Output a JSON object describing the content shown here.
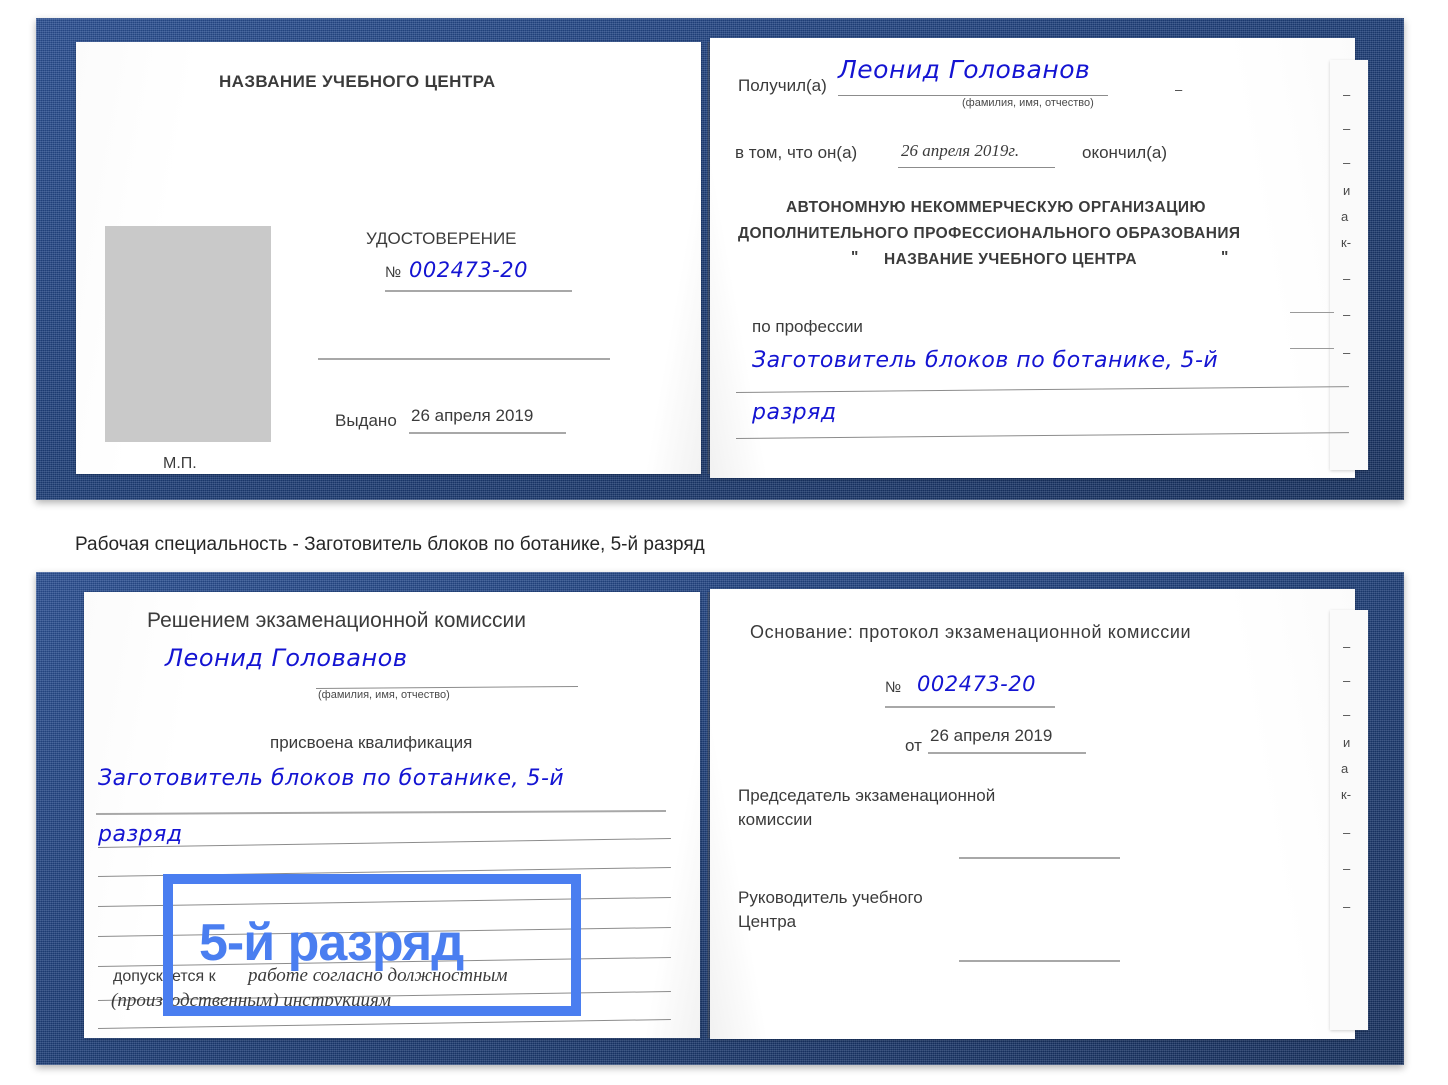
{
  "caption": "Рабочая специальность - Заготовитель блоков по ботанике, 5-й разряд",
  "cover_color": "#1e3f7a",
  "highlight_color": "#4a7ef0",
  "ink_color": "#1414d2",
  "certificate_top": {
    "left_page": {
      "heading": "НАЗВАНИЕ УЧЕБНОГО ЦЕНТРА",
      "doc_type": "УДОСТОВЕРЕНИЕ",
      "number_label": "№",
      "number_value": "002473-20",
      "issued_label": "Выдано",
      "issued_date": "26 апреля 2019",
      "seal_label": "М.П.",
      "photo_placeholder": "photo-placeholder"
    },
    "right_page": {
      "received_label": "Получил(а)",
      "received_name": "Леонид Голованов",
      "name_hint": "(фамилия, имя, отчество)",
      "that_he_label": "в том, что он(а)",
      "completion_date": "26 апреля 2019г.",
      "finished_label": "окончил(а)",
      "org_line1": "АВТОНОМНУЮ НЕКОММЕРЧЕСКУЮ ОРГАНИЗАЦИЮ",
      "org_line2": "ДОПОЛНИТЕЛЬНОГО ПРОФЕССИОНАЛЬНОГО ОБРАЗОВАНИЯ",
      "org_quote_open": "\"",
      "org_name": "НАЗВАНИЕ УЧЕБНОГО ЦЕНТРА",
      "org_quote_close": "\"",
      "profession_label": "по профессии",
      "profession_line1": "Заготовитель блоков по ботанике, 5-й",
      "profession_line2": "разряд"
    }
  },
  "certificate_bottom": {
    "left_page": {
      "heading": "Решением экзаменационной комиссии",
      "name": "Леонид Голованов",
      "name_hint": "(фамилия, имя, отчество)",
      "qualification_label": "присвоена квалификация",
      "qualification_line1": "Заготовитель блоков по ботанике, 5-й",
      "qualification_line2": "разряд",
      "allowed_label": "допускается к",
      "allowed_line1": "работе согласно должностным",
      "allowed_line2": "(производственным) инструкциям",
      "stamp_text": "5-й разряд"
    },
    "right_page": {
      "basis_label": "Основание: протокол экзаменационной комиссии",
      "number_label": "№",
      "number_value": "002473-20",
      "from_label": "от",
      "from_date": "26 апреля 2019",
      "chairman_line1": "Председатель экзаменационной",
      "chairman_line2": "комиссии",
      "head_line1": "Руководитель учебного",
      "head_line2": "Центра"
    }
  },
  "peek_marks": {
    "dashes": [
      "–",
      "–",
      "–",
      "и",
      "а",
      "к-",
      "–",
      "–",
      "–"
    ]
  }
}
